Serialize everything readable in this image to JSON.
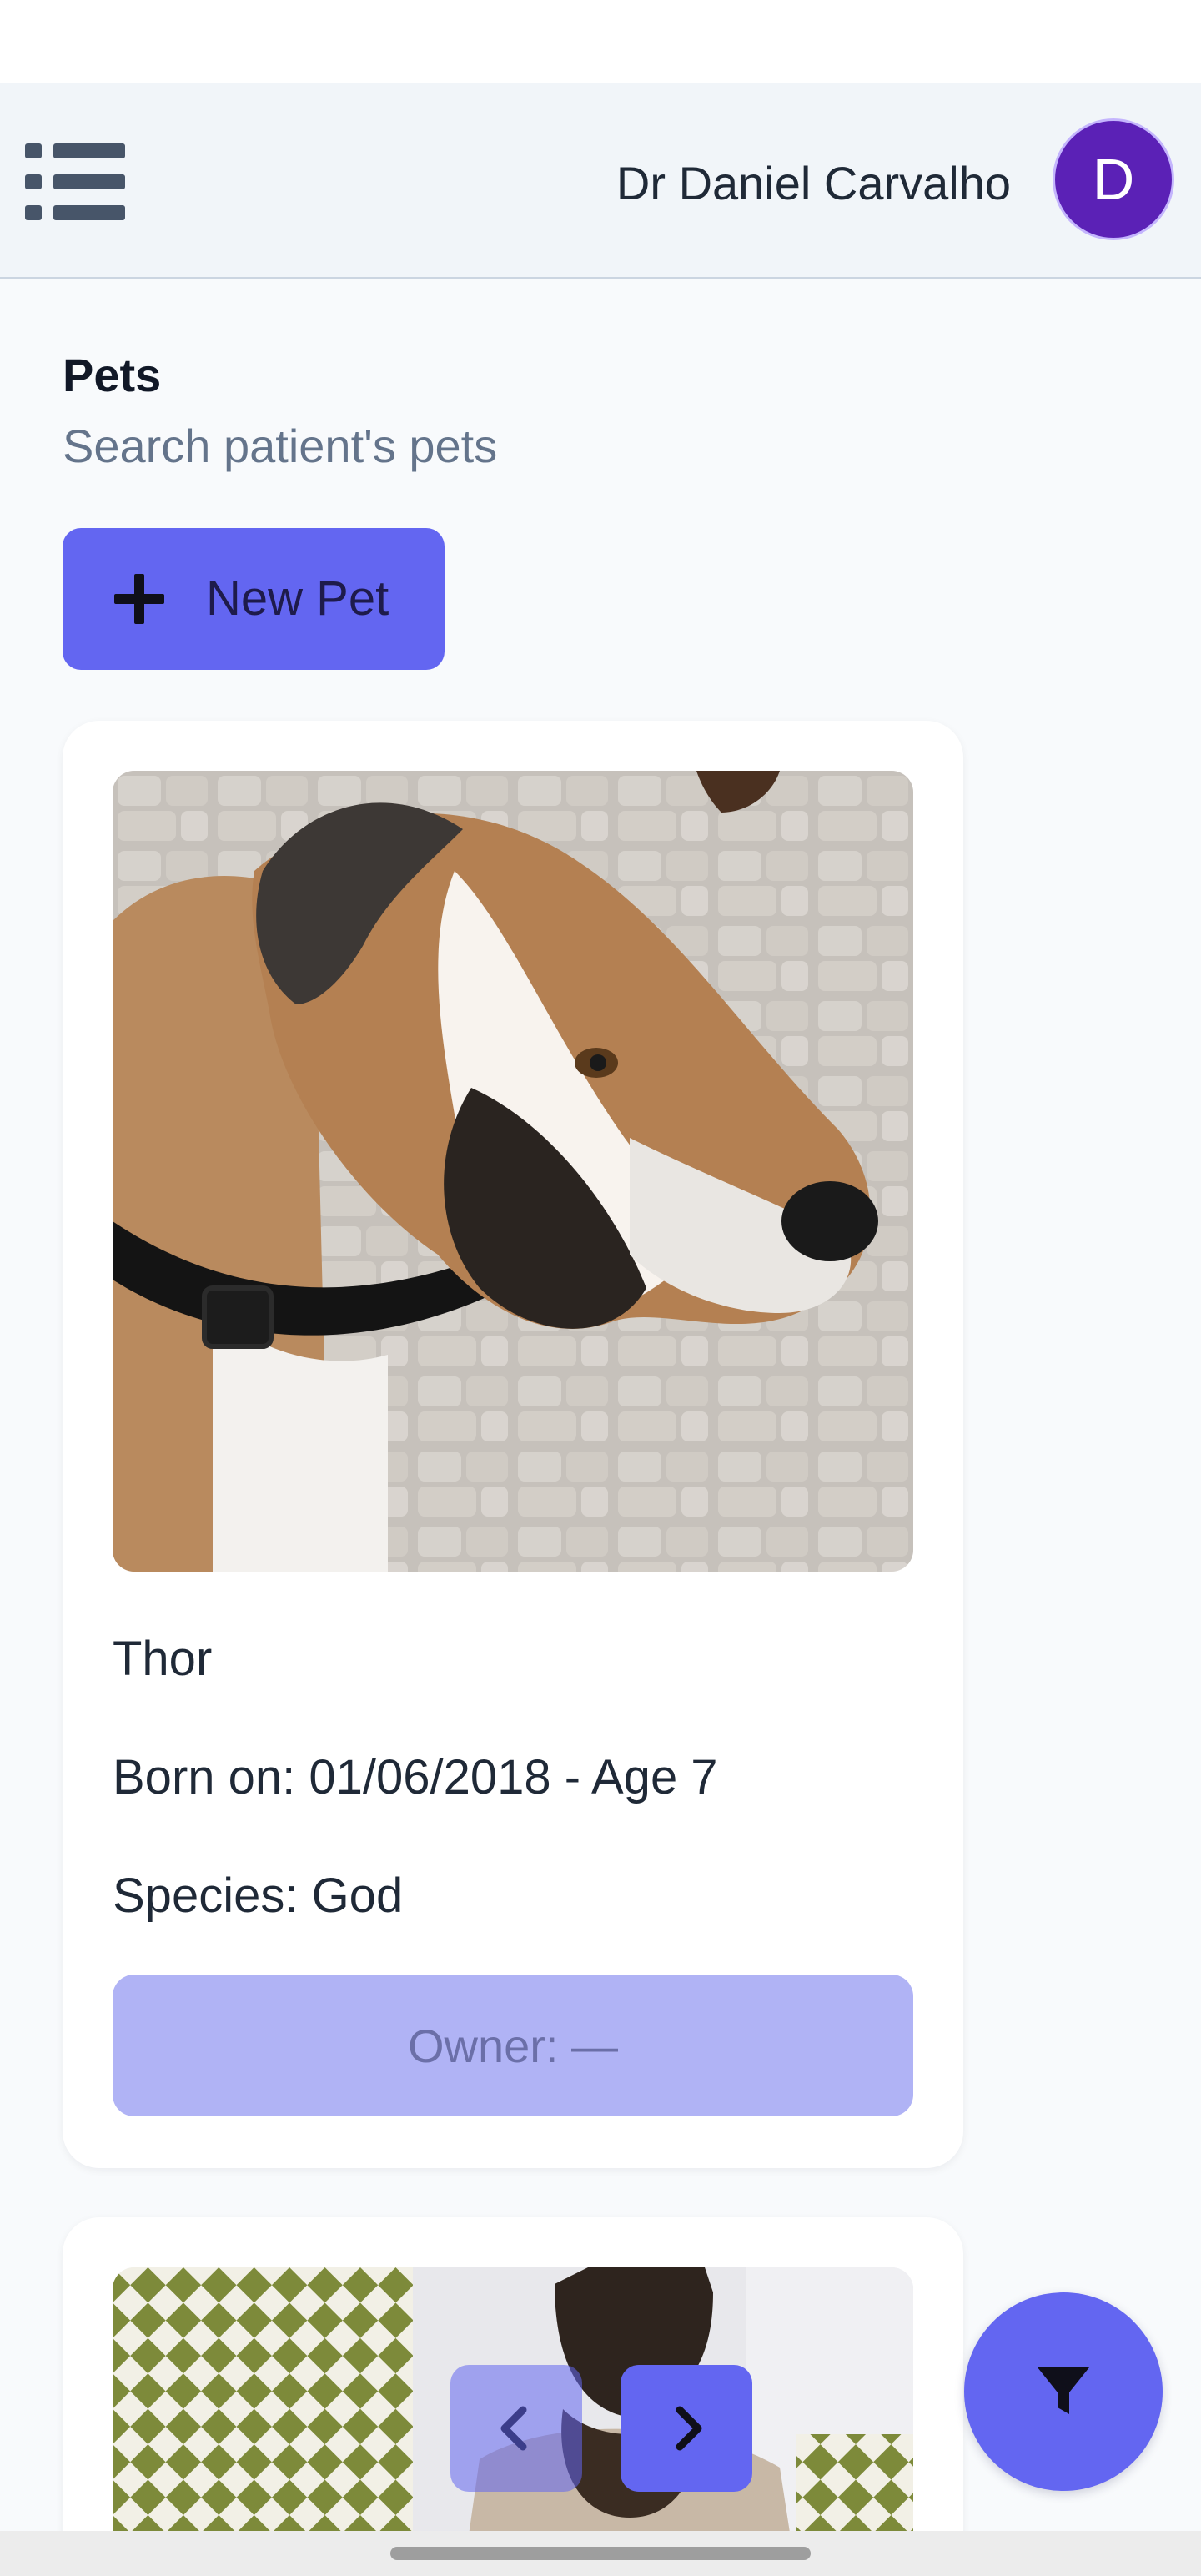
{
  "header": {
    "user_name": "Dr Daniel Carvalho",
    "avatar_initial": "D",
    "menu_icon": "list-menu-icon"
  },
  "page": {
    "title": "Pets",
    "subtitle": "Search patient's pets"
  },
  "actions": {
    "new_pet_label": "New Pet",
    "new_pet_icon": "plus-icon"
  },
  "pets": [
    {
      "name": "Thor",
      "born": "Born on: 01/06/2018 - Age 7",
      "species": "Species: God",
      "owner": "Owner: —",
      "photo": "brown-and-white-dog-photo"
    },
    {
      "photo": "siamese-cat-on-checkered-blanket-photo"
    }
  ],
  "pagination": {
    "prev_icon": "chevron-left-icon",
    "next_icon": "chevron-right-icon"
  },
  "fab": {
    "icon": "filter-icon"
  },
  "colors": {
    "primary": "#6366f1",
    "avatar": "#5b21b6",
    "owner_button": "#b0b3f5",
    "header_bg": "#f1f5f9",
    "page_bg": "#f8fafc"
  }
}
